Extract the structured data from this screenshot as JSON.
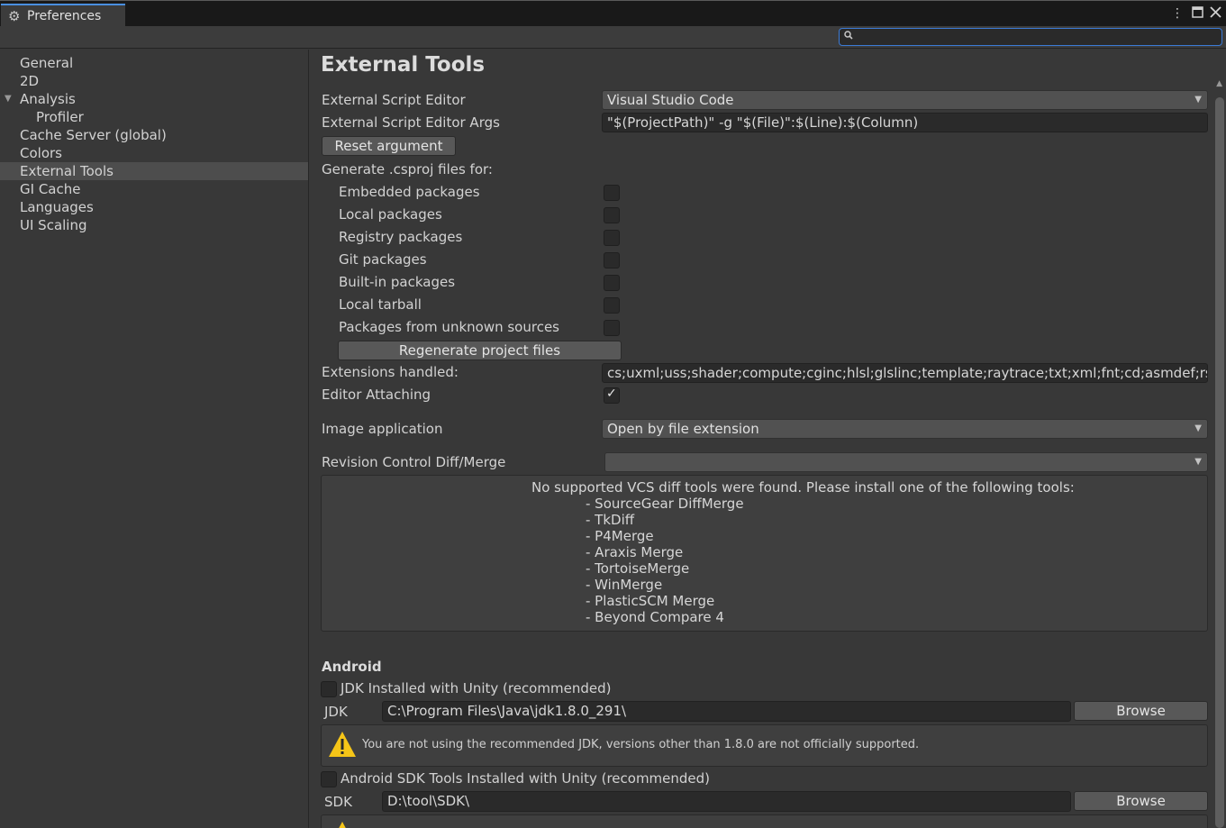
{
  "window": {
    "tab_title": "Preferences",
    "tab_icon": "gear-icon",
    "menu_icon": "kebab-menu-icon",
    "maximize_icon": "maximize-icon",
    "close_icon": "close-icon"
  },
  "search": {
    "placeholder": "",
    "icon": "search-icon"
  },
  "sidebar": {
    "items": [
      {
        "label": "General"
      },
      {
        "label": "2D"
      },
      {
        "label": "Analysis"
      },
      {
        "label": "Profiler"
      },
      {
        "label": "Cache Server (global)"
      },
      {
        "label": "Colors"
      },
      {
        "label": "External Tools"
      },
      {
        "label": "GI Cache"
      },
      {
        "label": "Languages"
      },
      {
        "label": "UI Scaling"
      }
    ],
    "selected": "External Tools"
  },
  "main": {
    "title": "External Tools",
    "external_script_editor": {
      "label": "External Script Editor",
      "value": "Visual Studio Code"
    },
    "external_script_editor_args": {
      "label": "External Script Editor Args",
      "value": "\"$(ProjectPath)\" -g \"$(File)\":$(Line):$(Column)"
    },
    "reset_argument": "Reset argument",
    "generate_label": "Generate .csproj files for:",
    "packages": [
      {
        "label": "Embedded packages",
        "checked": false
      },
      {
        "label": "Local packages",
        "checked": false
      },
      {
        "label": "Registry packages",
        "checked": false
      },
      {
        "label": "Git packages",
        "checked": false
      },
      {
        "label": "Built-in packages",
        "checked": false
      },
      {
        "label": "Local tarball",
        "checked": false
      },
      {
        "label": "Packages from unknown sources",
        "checked": false
      }
    ],
    "regenerate": "Regenerate project files",
    "extensions": {
      "label": "Extensions handled:",
      "value": "cs;uxml;uss;shader;compute;cginc;hlsl;glslinc;template;raytrace;txt;xml;fnt;cd;asmdef;rsp;asmref"
    },
    "editor_attaching": {
      "label": "Editor Attaching",
      "checked": true
    },
    "image_application": {
      "label": "Image application",
      "value": "Open by file extension"
    },
    "revision_control": {
      "label": "Revision Control Diff/Merge",
      "value": ""
    },
    "vcs_message": "No supported VCS diff tools were found. Please install one of the following tools:",
    "vcs_tools": [
      "- SourceGear DiffMerge",
      "- TkDiff",
      "- P4Merge",
      "- Araxis Merge",
      "- TortoiseMerge",
      "- WinMerge",
      "- PlasticSCM Merge",
      "- Beyond Compare 4"
    ],
    "android": {
      "title": "Android",
      "jdk_installed": {
        "label": "JDK Installed with Unity (recommended)",
        "checked": false
      },
      "jdk": {
        "label": "JDK",
        "value": "C:\\Program Files\\Java\\jdk1.8.0_291\\",
        "browse": "Browse"
      },
      "jdk_warning": "You are not using the recommended JDK, versions other than 1.8.0 are not officially supported.",
      "sdk_installed": {
        "label": "Android SDK Tools Installed with Unity (recommended)",
        "checked": false
      },
      "sdk": {
        "label": "SDK",
        "value": "D:\\tool\\SDK\\",
        "browse": "Browse"
      }
    }
  },
  "colors": {
    "accent": "#3b7bd6",
    "warning": "#f5c518"
  }
}
